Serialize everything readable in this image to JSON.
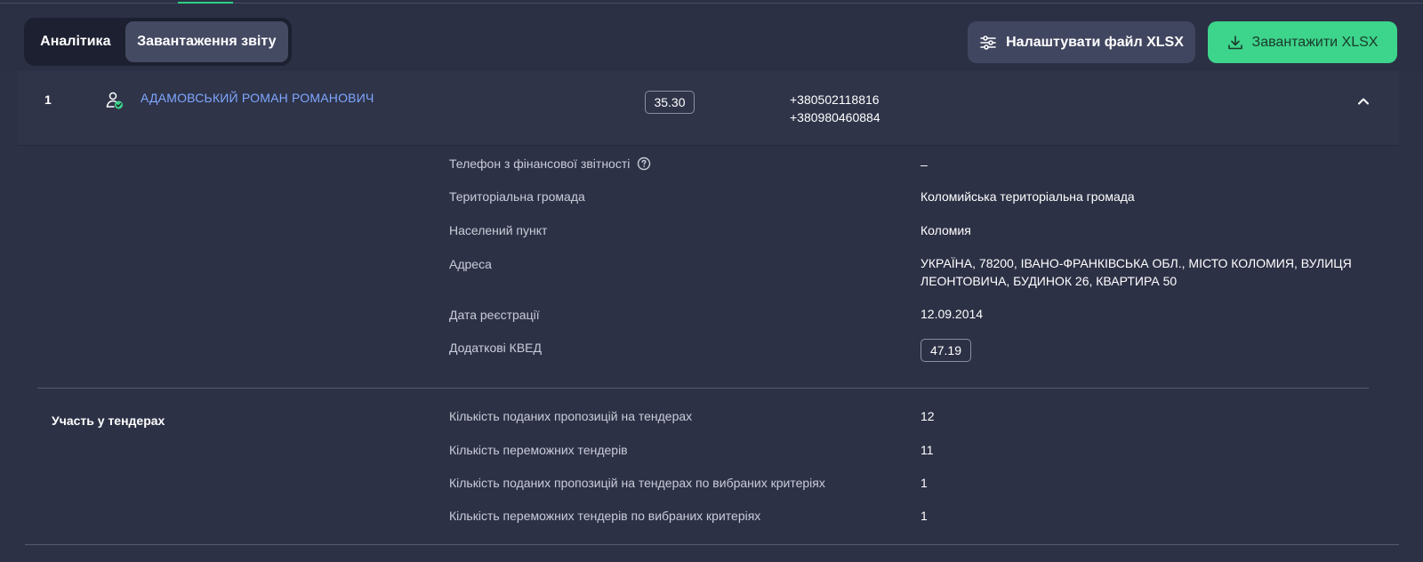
{
  "tabs": [
    {
      "label": "Аналітика",
      "active": false
    },
    {
      "label": "Завантаження звіту",
      "active": true
    }
  ],
  "actions": {
    "settings_label": "Налаштувати файл XLSX",
    "download_label": "Завантажити XLSX"
  },
  "row": {
    "number": "1",
    "name": "АДАМОВСЬКИЙ РОМАН РОМАНОВИЧ",
    "score": "35.30",
    "phones": [
      "+380502118816",
      "+380980460884"
    ]
  },
  "details": [
    {
      "label": "Телефон з фінансової звітності",
      "value": "–"
    },
    {
      "label": "Територіальна громада",
      "value": "Коломийська територіальна громада"
    },
    {
      "label": "Населений пункт",
      "value": "Коломия"
    },
    {
      "label": "Адреса",
      "value": "УКРАЇНА, 78200, ІВАНО-ФРАНКІВСЬКА ОБЛ., МІСТО КОЛОМИЯ, ВУЛИЦЯ ЛЕОНТОВИЧА, БУДИНОК 26, КВАРТИРА 50"
    },
    {
      "label": "Дата реєстрації",
      "value": "12.09.2014"
    },
    {
      "label": "Додаткові КВЕД",
      "value": "47.19"
    }
  ],
  "tenders": {
    "title": "Участь у тендерах",
    "items": [
      {
        "label": "Кількість поданих пропозицій на тендерах",
        "value": "12"
      },
      {
        "label": "Кількість переможних тендерів",
        "value": "11"
      },
      {
        "label": "Кількість поданих пропозицій на тендерах по вибраних критеріях",
        "value": "1"
      },
      {
        "label": "Кількість переможних тендерів по вибраних критеріях",
        "value": "1"
      }
    ]
  },
  "colors": {
    "background": "#2d3146",
    "accent_green": "#3dd48b",
    "link_blue": "#7fa7ff"
  },
  "icons": [
    "settings-sliders-icon",
    "download-icon",
    "person-verified-icon",
    "chevron-up-icon",
    "help-icon"
  ]
}
